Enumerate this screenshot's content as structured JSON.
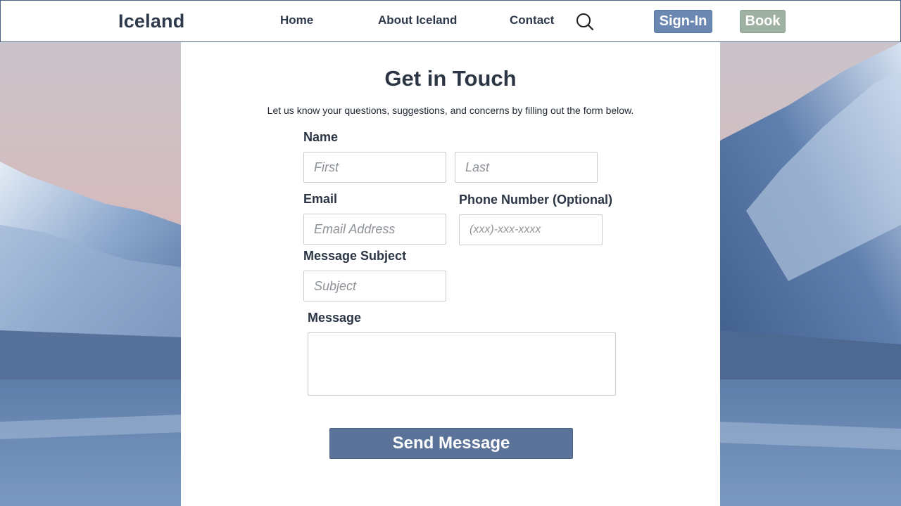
{
  "header": {
    "brand": "Iceland",
    "nav": [
      "Home",
      "About Iceland",
      "Contact"
    ],
    "search_icon": "search-icon",
    "signin_label": "Sign-In",
    "book_label": "Book"
  },
  "form": {
    "title": "Get in Touch",
    "subtitle": "Let us know your questions, suggestions, and concerns by filling out the form below.",
    "name_label": "Name",
    "first_placeholder": "First",
    "last_placeholder": "Last",
    "email_label": "Email",
    "email_placeholder": "Email Address",
    "phone_label": "Phone Number (Optional)",
    "phone_placeholder": "(xxx)-xxx-xxxx",
    "subject_label": "Message Subject",
    "subject_placeholder": "Subject",
    "message_label": "Message",
    "message_value": "",
    "send_label": "Send Message"
  },
  "colors": {
    "accent": "#5b7399",
    "signin": "#6b88b2",
    "book": "#9fb1a3",
    "text": "#2b3544"
  }
}
